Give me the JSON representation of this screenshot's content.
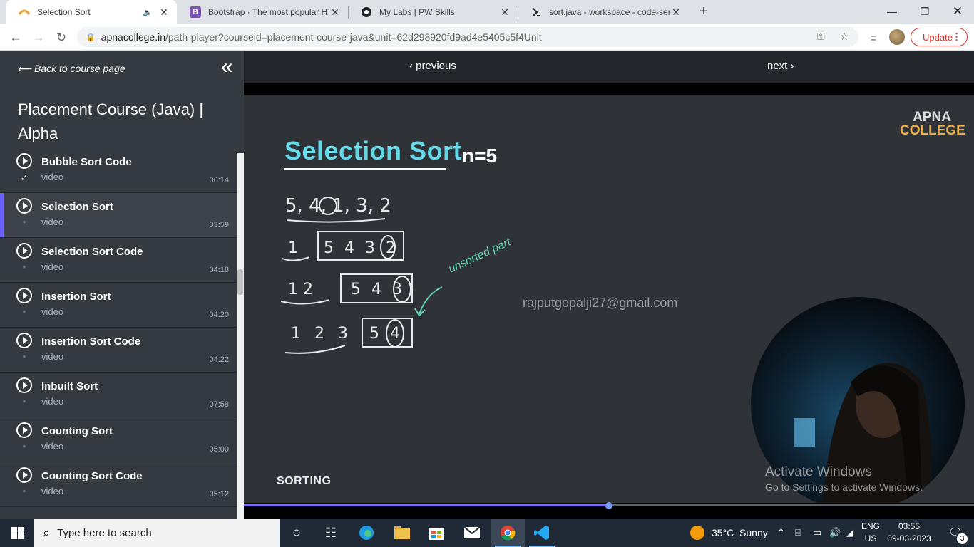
{
  "browser": {
    "tabs": [
      {
        "title": "Selection Sort",
        "favicon_color": "#e8a33a",
        "active": true,
        "audio": true
      },
      {
        "title": "Bootstrap · The most popular HTML",
        "favicon_color": "#7952b3",
        "favicon_letter": "B",
        "active": false
      },
      {
        "title": "My Labs | PW Skills",
        "favicon_color": "#202124",
        "active": false
      },
      {
        "title": "sort.java - workspace - code-server",
        "favicon_color": "#202124",
        "active": false
      }
    ],
    "url_host": "apnacollege.in",
    "url_path": "/path-player?courseid=placement-course-java&unit=62d298920fd9ad4e5405c5f4Unit",
    "update_label": "Update"
  },
  "sidebar": {
    "back_label": "Back to course page",
    "course_title": "Placement Course (Java) | Alpha",
    "lessons": [
      {
        "title": "Bubble Sort Code",
        "type": "video",
        "duration": "06:14",
        "status": "done"
      },
      {
        "title": "Selection Sort",
        "type": "video",
        "duration": "03:59",
        "status": "current"
      },
      {
        "title": "Selection Sort Code",
        "type": "video",
        "duration": "04:18",
        "status": "pending"
      },
      {
        "title": "Insertion Sort",
        "type": "video",
        "duration": "04:20",
        "status": "pending"
      },
      {
        "title": "Insertion Sort Code",
        "type": "video",
        "duration": "04:22",
        "status": "pending"
      },
      {
        "title": "Inbuilt Sort",
        "type": "video",
        "duration": "07:58",
        "status": "pending"
      },
      {
        "title": "Counting Sort",
        "type": "video",
        "duration": "05:00",
        "status": "pending"
      },
      {
        "title": "Counting Sort Code",
        "type": "video",
        "duration": "05:12",
        "status": "pending"
      }
    ]
  },
  "player": {
    "previous_label": "previous",
    "next_label": "next",
    "slide_title": "Selection Sort",
    "slide_n": "n=5",
    "handwritten_array": "5, 4, 1, 3, 2",
    "handwritten_steps": [
      {
        "sorted": "1",
        "unsorted": "5 4 3 2"
      },
      {
        "sorted": "1 2",
        "unsorted": "5 4 3"
      },
      {
        "sorted": "1 2 3",
        "unsorted": "5 4"
      }
    ],
    "handwritten_note": "unsorted part",
    "watermark_email": "rajputgopalji27@gmail.com",
    "brand_line1": "APNA",
    "brand_line2": "COLLEGE",
    "section_label": "SORTING",
    "progress_fraction": 0.5,
    "activate_title": "Activate Windows",
    "activate_sub": "Go to Settings to activate Windows."
  },
  "taskbar": {
    "search_placeholder": "Type here to search",
    "weather": "35°C  Sunny",
    "lang_line1": "ENG",
    "lang_line2": "US",
    "time": "03:55",
    "date": "09-03-2023",
    "notifications": "3"
  },
  "colors": {
    "accent": "#6c63ff",
    "sidebar": "#343a40",
    "slide_title": "#66d9e8"
  }
}
